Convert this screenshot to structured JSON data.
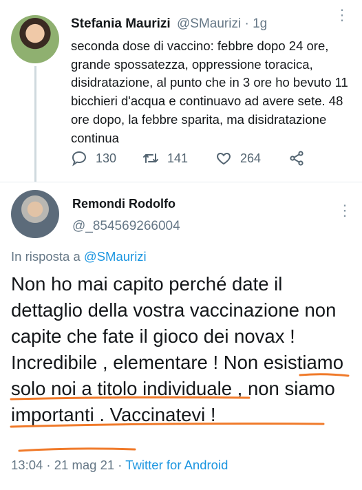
{
  "tweet1": {
    "name": "Stefania Maurizi",
    "handle": "@SMaurizi",
    "sep": "·",
    "time": "1g",
    "more": "⋮",
    "text": "seconda dose di vaccino: febbre dopo 24 ore, grande spossatezza, oppressione toracica, disidratazione, al punto che in 3 ore ho bevuto 11 bicchieri d'acqua e continuavo ad avere sete. 48 ore dopo, la febbre sparita, ma disidratazione continua",
    "replies": "130",
    "retweets": "141",
    "likes": "264"
  },
  "tweet2": {
    "name": "Remondi Rodolfo",
    "handle": "@_854569266004",
    "more": "⋮",
    "reply_prefix": "In risposta a",
    "reply_to": "@SMaurizi",
    "text": "Non ho mai capito perché date il dettaglio della vostra vaccinazione non capite che fate il gioco dei novax ! Incredibile , elementare ! Non esistiamo solo noi a titolo individuale , non siamo importanti . Vaccinatevi !",
    "timestamp": "13:04 · 21 mag 21 · ",
    "app": "Twitter for Android"
  },
  "colors": {
    "accent": "#1b95e0",
    "secondary_text": "#657786",
    "annotation": "#f07a2a"
  }
}
